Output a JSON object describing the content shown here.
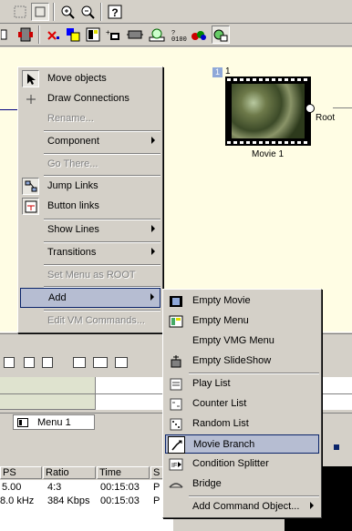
{
  "context_menu": {
    "items": [
      {
        "label": "Move objects",
        "icon": "arrow-cursor-icon",
        "disabled": false,
        "submenu": false
      },
      {
        "label": "Draw Connections",
        "icon": "crosshair-icon",
        "disabled": false,
        "submenu": false
      },
      {
        "label": "Rename...",
        "icon": "",
        "disabled": true,
        "submenu": false
      },
      {
        "label": "Component",
        "icon": "",
        "disabled": false,
        "submenu": true
      },
      {
        "label": "Go There...",
        "icon": "",
        "disabled": true,
        "submenu": false
      },
      {
        "label": "Jump Links",
        "icon": "jump-links-icon",
        "disabled": false,
        "submenu": false
      },
      {
        "label": "Button links",
        "icon": "button-links-icon",
        "disabled": false,
        "submenu": false
      },
      {
        "label": "Show Lines",
        "icon": "",
        "disabled": false,
        "submenu": true
      },
      {
        "label": "Transitions",
        "icon": "",
        "disabled": false,
        "submenu": true
      },
      {
        "label": "Set Menu as ROOT",
        "icon": "",
        "disabled": true,
        "submenu": false
      },
      {
        "label": "Add",
        "icon": "",
        "disabled": false,
        "submenu": true
      },
      {
        "label": "Edit VM Commands...",
        "icon": "",
        "disabled": true,
        "submenu": false
      }
    ]
  },
  "add_submenu": {
    "items": [
      {
        "label": "Empty Movie",
        "icon": "film-icon"
      },
      {
        "label": "Empty Menu",
        "icon": "menu-icon"
      },
      {
        "label": "Empty VMG Menu",
        "icon": ""
      },
      {
        "label": "Empty SlideShow",
        "icon": "slideshow-icon"
      },
      {
        "label": "Play List",
        "icon": "list-icon"
      },
      {
        "label": "Counter List",
        "icon": "counter-list-icon"
      },
      {
        "label": "Random List",
        "icon": "dice-icon"
      },
      {
        "label": "Movie Branch",
        "icon": "branch-icon"
      },
      {
        "label": "Condition Splitter",
        "icon": "splitter-icon"
      },
      {
        "label": "Bridge",
        "icon": "bridge-icon"
      },
      {
        "label": "Add Command Object...",
        "icon": ""
      }
    ]
  },
  "movie_node": {
    "badge": "1",
    "number": "1",
    "title": "Movie 1",
    "root_label": "Root"
  },
  "tab": {
    "label": "Menu 1"
  },
  "table": {
    "headers": [
      "PS",
      "Ratio",
      "Time",
      "S"
    ],
    "rows": [
      [
        "5.00",
        "4:3",
        "00:15:03",
        "P"
      ],
      [
        "8.0 kHz",
        "384 Kbps",
        "00:15:03",
        "P"
      ]
    ]
  },
  "toolbar": {
    "row1_icons": [
      "grid-icon",
      "select-icon",
      "zoom-in-icon",
      "zoom-out-icon",
      "help-icon"
    ],
    "row2_icons": [
      "dock-icon",
      "connect-icon",
      "delete-link-icon",
      "color-icon",
      "menu-icon",
      "add-icon",
      "vm-icon",
      "disc-icon",
      "counter-icon",
      "random-icon",
      "branch-icon"
    ]
  }
}
